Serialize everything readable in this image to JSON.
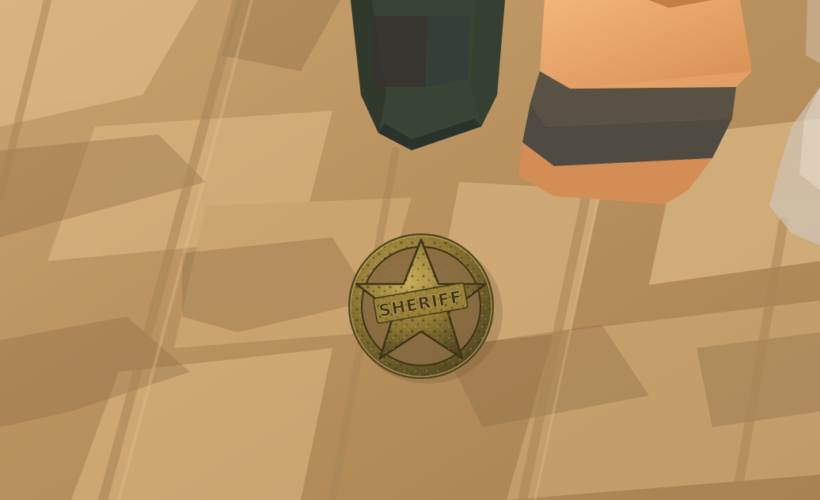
{
  "scene": {
    "badge": {
      "text": "SHERIFF"
    },
    "colors": {
      "floor_light": "#d7b17d",
      "floor_mid": "#b9935f",
      "floor_shadow": "#8f7049",
      "plank_gap": "#a98656",
      "badge_gold": "#a88b3e",
      "badge_dark": "#4f4420",
      "bottle_green": "#3a4434",
      "barrel_orange": "#d9945a",
      "barrel_band": "#5a5145"
    }
  }
}
